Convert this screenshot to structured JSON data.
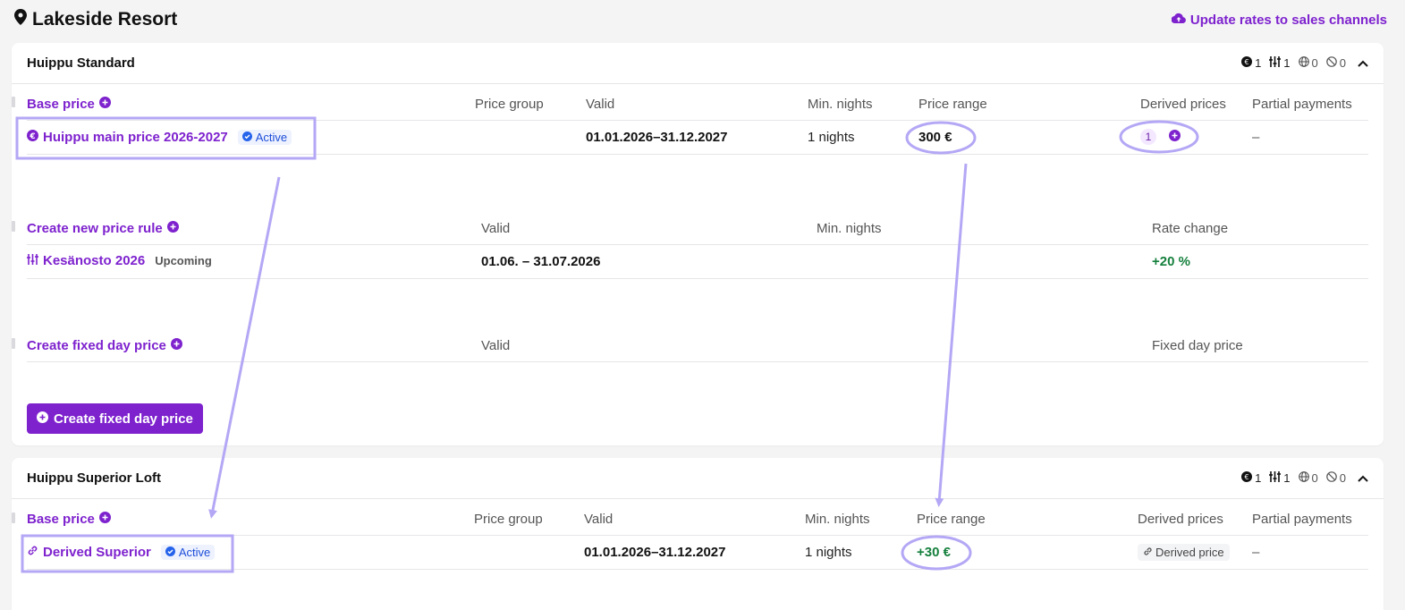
{
  "header": {
    "title": "Lakeside Resort",
    "update_label": "Update rates to sales channels"
  },
  "colors": {
    "accent": "#7e22ce",
    "positive": "#15803d",
    "active_badge": "#1d4ed8",
    "annotation": "#b4a7f5"
  },
  "rooms": [
    {
      "name": "Huippu Standard",
      "stats": [
        "1",
        "1",
        "0",
        "0"
      ],
      "base_price": {
        "columns": [
          "Base price",
          "Price group",
          "Valid",
          "Min. nights",
          "Price range",
          "Derived prices",
          "Partial payments"
        ],
        "rows": [
          {
            "name": "Huippu main price 2026-2027",
            "status": "Active",
            "price_group": "",
            "valid": "01.01.2026–31.12.2027",
            "min_nights": "1 nights",
            "price_range": "300 €",
            "derived_count": "1",
            "partial": "–"
          }
        ]
      },
      "price_rules": {
        "columns": [
          "Create new price rule",
          "Valid",
          "Min. nights",
          "Rate change"
        ],
        "rows": [
          {
            "name": "Kesänosto 2026",
            "status": "Upcoming",
            "valid": "01.06. – 31.07.2026",
            "min_nights": "",
            "rate_change": "+20 %"
          }
        ]
      },
      "fixed_day": {
        "columns": [
          "Create fixed day price",
          "Valid",
          "Fixed day price"
        ],
        "button_label": "Create fixed day price"
      }
    },
    {
      "name": "Huippu Superior Loft",
      "stats": [
        "1",
        "1",
        "0",
        "0"
      ],
      "base_price": {
        "columns": [
          "Base price",
          "Price group",
          "Valid",
          "Min. nights",
          "Price range",
          "Derived prices",
          "Partial payments"
        ],
        "rows": [
          {
            "name": "Derived Superior",
            "status": "Active",
            "price_group": "",
            "valid": "01.01.2026–31.12.2027",
            "min_nights": "1 nights",
            "price_range": "+30 €",
            "derived_label": "Derived price",
            "partial": "–"
          }
        ]
      }
    }
  ]
}
